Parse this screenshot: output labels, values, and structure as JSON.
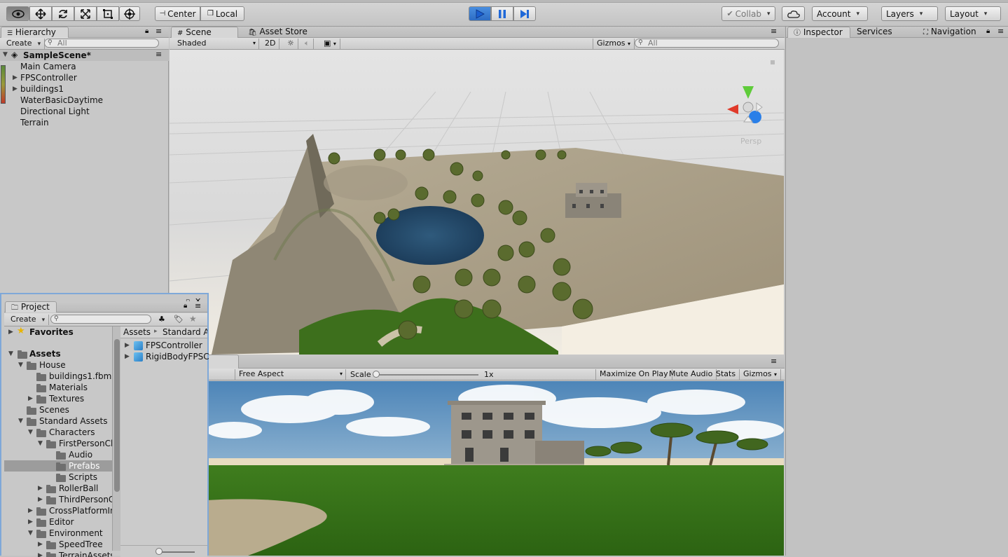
{
  "toolbar": {
    "center": "Center",
    "local": "Local",
    "collab": "Collab",
    "account": "Account",
    "layers": "Layers",
    "layout": "Layout"
  },
  "hierarchy": {
    "tab": "Hierarchy",
    "create": "Create",
    "search_placeholder": "All",
    "scene": "SampleScene*",
    "items": [
      "Main Camera",
      "FPSController",
      "buildings1",
      "WaterBasicDaytime",
      "Directional Light",
      "Terrain"
    ]
  },
  "scene": {
    "tab_scene": "Scene",
    "tab_store": "Asset Store",
    "shaded": "Shaded",
    "mode2d": "2D",
    "gizmos": "Gizmos",
    "search_placeholder": "All",
    "persp": "Persp"
  },
  "game": {
    "aspect": "Free Aspect",
    "scale_label": "Scale",
    "scale_value": "1x",
    "maximize": "Maximize On Play",
    "mute": "Mute Audio",
    "stats": "Stats",
    "gizmos": "Gizmos"
  },
  "inspector": {
    "tab_inspector": "Inspector",
    "tab_services": "Services",
    "tab_navigation": "Navigation"
  },
  "project": {
    "tab": "Project",
    "create": "Create",
    "favorites": "Favorites",
    "assets": "Assets",
    "breadcrumb_root": "Assets",
    "breadcrumb_next": "Standard A",
    "tree": [
      {
        "label": "House",
        "depth": 1,
        "arrow": "open"
      },
      {
        "label": "buildings1.fbm",
        "depth": 2,
        "arrow": ""
      },
      {
        "label": "Materials",
        "depth": 2,
        "arrow": ""
      },
      {
        "label": "Textures",
        "depth": 2,
        "arrow": "closed"
      },
      {
        "label": "Scenes",
        "depth": 1,
        "arrow": ""
      },
      {
        "label": "Standard Assets",
        "depth": 1,
        "arrow": "open"
      },
      {
        "label": "Characters",
        "depth": 2,
        "arrow": "open"
      },
      {
        "label": "FirstPersonCh",
        "depth": 3,
        "arrow": "open"
      },
      {
        "label": "Audio",
        "depth": 4,
        "arrow": ""
      },
      {
        "label": "Prefabs",
        "depth": 4,
        "arrow": "",
        "selected": true
      },
      {
        "label": "Scripts",
        "depth": 4,
        "arrow": ""
      },
      {
        "label": "RollerBall",
        "depth": 3,
        "arrow": "closed"
      },
      {
        "label": "ThirdPersonC",
        "depth": 3,
        "arrow": "closed"
      },
      {
        "label": "CrossPlatformIn",
        "depth": 2,
        "arrow": "closed"
      },
      {
        "label": "Editor",
        "depth": 2,
        "arrow": "closed"
      },
      {
        "label": "Environment",
        "depth": 2,
        "arrow": "open"
      },
      {
        "label": "SpeedTree",
        "depth": 3,
        "arrow": "closed"
      },
      {
        "label": "TerrainAssets",
        "depth": 3,
        "arrow": "closed"
      }
    ],
    "files": [
      "FPSController",
      "RigidBodyFPSC"
    ]
  }
}
